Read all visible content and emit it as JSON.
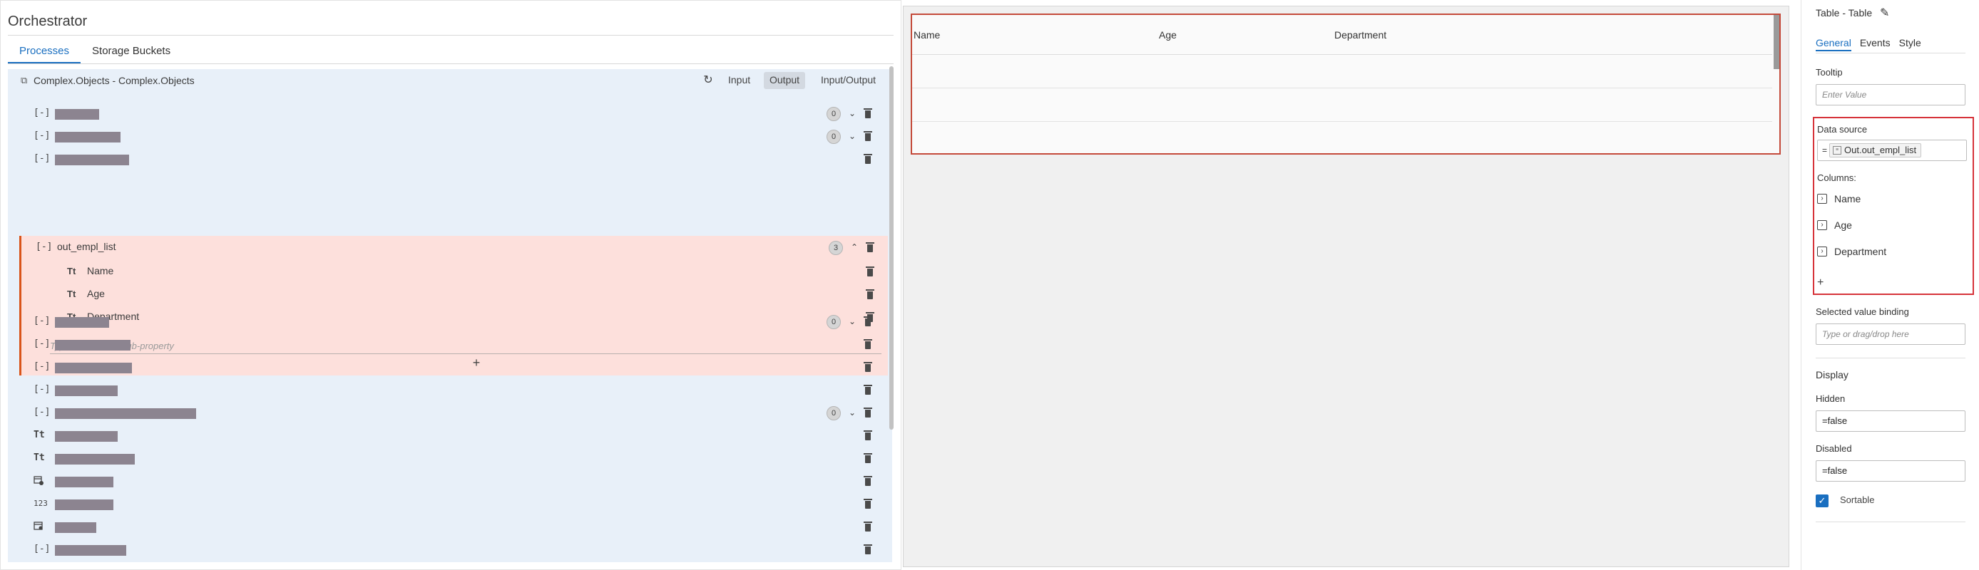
{
  "orchestrator": {
    "title": "Orchestrator",
    "tabs": [
      {
        "label": "Processes",
        "active": true
      },
      {
        "label": "Storage Buckets",
        "active": false
      }
    ]
  },
  "tree": {
    "header_label": "Complex.Objects - Complex.Objects",
    "modes": [
      "Input",
      "Output",
      "Input/Output"
    ],
    "active_mode": "Output",
    "rows_before": [
      {
        "icon": "[-]",
        "badge": "0",
        "has_chevron": true
      },
      {
        "icon": "[-]",
        "badge": "0",
        "has_chevron": true
      },
      {
        "icon": "[-]",
        "badge": null,
        "has_chevron": false
      }
    ],
    "expanded": {
      "icon": "[-]",
      "name": "out_empl_list",
      "badge": "3",
      "children": [
        {
          "icon": "Tt",
          "name": "Name"
        },
        {
          "icon": "Tt",
          "name": "Age"
        },
        {
          "icon": "Tt",
          "name": "Department"
        }
      ],
      "sub_placeholder": "Type here to add sub-property",
      "add_glyph": "+"
    },
    "rows_after": [
      {
        "icon": "[-]",
        "badge": "0",
        "has_chevron": true
      },
      {
        "icon": "[-]",
        "badge": null,
        "has_chevron": false
      },
      {
        "icon": "[-]",
        "badge": null,
        "has_chevron": false
      },
      {
        "icon": "[-]",
        "badge": null,
        "has_chevron": false
      },
      {
        "icon": "[-]",
        "badge": "0",
        "has_chevron": true
      },
      {
        "icon": "Tt",
        "badge": null,
        "has_chevron": false
      },
      {
        "icon": "Tt",
        "badge": null,
        "has_chevron": false
      },
      {
        "icon": "date-check-icon",
        "badge": null,
        "has_chevron": false
      },
      {
        "icon": "123",
        "badge": null,
        "has_chevron": false
      },
      {
        "icon": "calendar-icon",
        "badge": null,
        "has_chevron": false
      },
      {
        "icon": "[-]",
        "badge": null,
        "has_chevron": false
      }
    ]
  },
  "table_preview": {
    "columns": [
      "Name",
      "Age",
      "Department"
    ],
    "empty_rows": 3
  },
  "properties": {
    "title": "Table - Table",
    "tabs": [
      {
        "label": "General",
        "active": true
      },
      {
        "label": "Events",
        "active": false
      },
      {
        "label": "Style",
        "active": false
      }
    ],
    "tooltip_label": "Tooltip",
    "tooltip_placeholder": "Enter Value",
    "data_source_label": "Data source",
    "data_source_eq": "=",
    "data_source_value": "Out.out_empl_list",
    "columns_label": "Columns:",
    "columns": [
      "Name",
      "Age",
      "Department"
    ],
    "add_column_glyph": "+",
    "selected_binding_label": "Selected value binding",
    "selected_binding_placeholder": "Type or drag/drop here",
    "display_label": "Display",
    "hidden_label": "Hidden",
    "hidden_value": "=false",
    "disabled_label": "Disabled",
    "disabled_value": "=false",
    "sortable_label": "Sortable",
    "sortable_checked": true
  },
  "colors": {
    "accent": "#1a6fc0",
    "tree_bg": "#e8f0f9",
    "expanded_bg": "#fde0dc",
    "expanded_border": "#d9541a",
    "highlight_red": "#d6333a"
  }
}
